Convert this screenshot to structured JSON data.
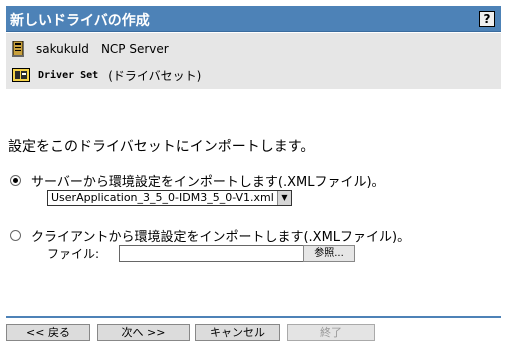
{
  "window": {
    "title": "新しいドライバの作成",
    "help_glyph": "?",
    "help_icon": "help-icon"
  },
  "info": {
    "server_icon": "server-icon",
    "server_name": "sakukuld",
    "server_type": "NCP Server",
    "driver_set_icon": "driver-set-icon",
    "driver_set_name": "Driver Set",
    "driver_set_type": "(ドライバセット)"
  },
  "main": {
    "heading": "設定をこのドライバセットにインポートします。",
    "server_option": {
      "label": "サーバーから環境設定をインポートします(.XMLファイル)。",
      "checked": true,
      "selected_file": "UserApplication_3_5_0-IDM3_5_0-V1.xml",
      "dropdown_glyph": "▼"
    },
    "client_option": {
      "label": "クライアントから環境設定をインポートします(.XMLファイル)。",
      "checked": false,
      "file_label": "ファイル:",
      "file_value": "",
      "browse_label": "参照..."
    }
  },
  "footer": {
    "back_label": "<< 戻る",
    "next_label": "次へ >>",
    "cancel_label": "キャンセル",
    "finish_label": "終了",
    "finish_enabled": false
  },
  "colors": {
    "title_bar": "#4d82b7",
    "panel": "#e6e6e6",
    "button": "#dcdcdc"
  }
}
